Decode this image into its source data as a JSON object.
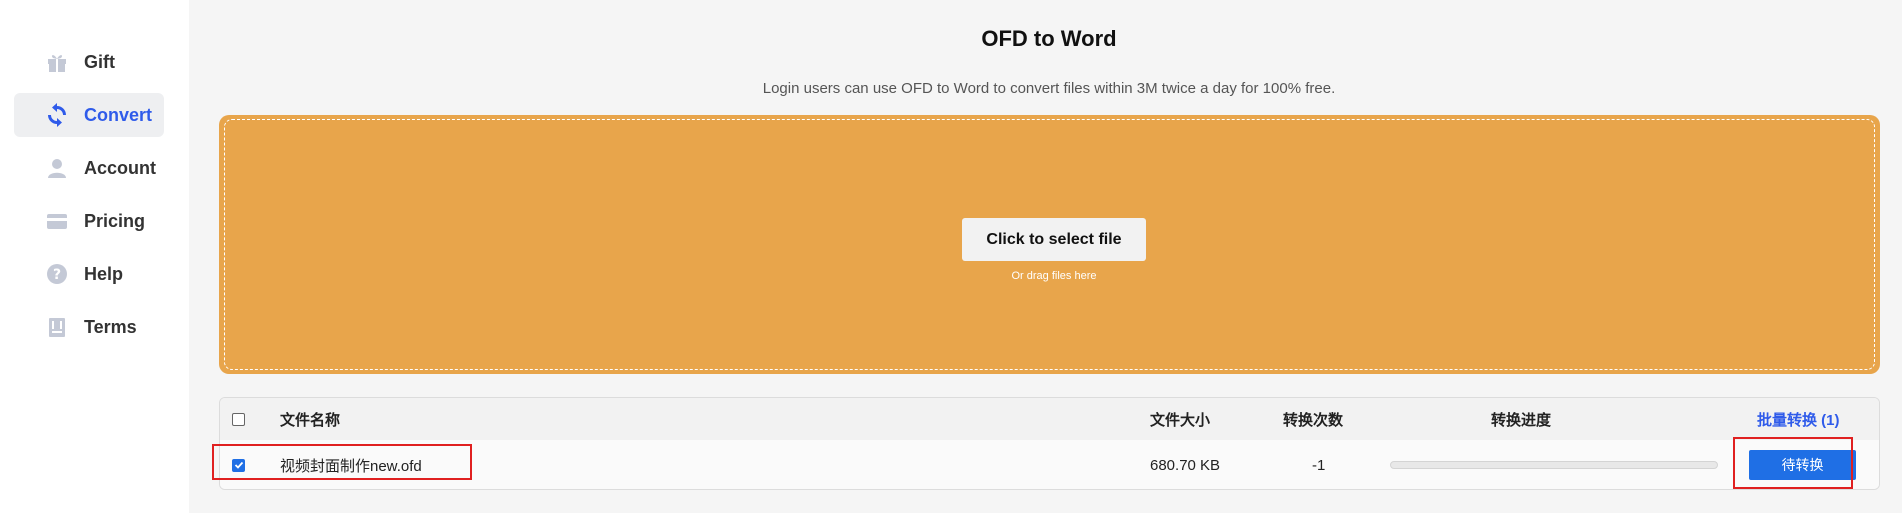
{
  "sidebar": {
    "items": [
      {
        "label": "Gift",
        "icon": "gift-icon",
        "active": false
      },
      {
        "label": "Convert",
        "icon": "convert-icon",
        "active": true
      },
      {
        "label": "Account",
        "icon": "user-icon",
        "active": false
      },
      {
        "label": "Pricing",
        "icon": "card-icon",
        "active": false
      },
      {
        "label": "Help",
        "icon": "help-icon",
        "active": false
      },
      {
        "label": "Terms",
        "icon": "terms-icon",
        "active": false
      }
    ]
  },
  "main": {
    "title": "OFD to Word",
    "subtitle": "Login users can use OFD to Word to convert files within 3M twice a day for 100% free."
  },
  "dropzone": {
    "button_label": "Click to select file",
    "hint": "Or drag files here"
  },
  "table": {
    "headers": {
      "name": "文件名称",
      "size": "文件大小",
      "count": "转换次数",
      "progress": "转换进度",
      "batch": "批量转换 (1)"
    },
    "rows": [
      {
        "name": "视频封面制作new.ofd",
        "size": "680.70 KB",
        "count": "-1",
        "progress": 0,
        "action": "待转换",
        "checked": true
      }
    ]
  },
  "colors": {
    "accent": "#2f5bea",
    "dropzone": "#e8a54b",
    "button": "#1f6fe5",
    "highlight": "#e02020"
  }
}
